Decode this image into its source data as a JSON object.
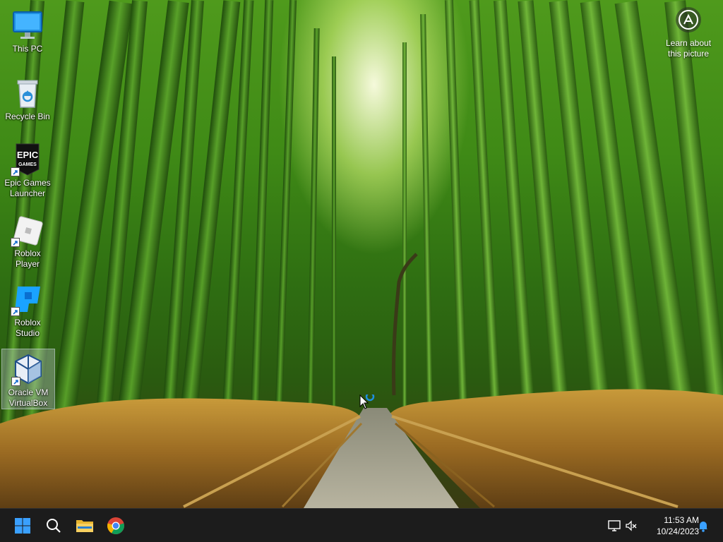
{
  "desktop": {
    "icons": [
      {
        "label": "This PC",
        "icon": "monitor-icon"
      },
      {
        "label": "Recycle Bin",
        "icon": "recycle-bin-icon"
      },
      {
        "label": "Epic Games Launcher",
        "icon": "epic-games-icon"
      },
      {
        "label": "Roblox Player",
        "icon": "roblox-player-icon"
      },
      {
        "label": "Roblox Studio",
        "icon": "roblox-studio-icon"
      },
      {
        "label": "Oracle VM VirtualBox",
        "icon": "virtualbox-icon"
      }
    ],
    "learn_about_picture": "Learn about this picture",
    "epic_logo_text": "EPIC GAMES"
  },
  "taskbar": {
    "items": [
      {
        "name": "start",
        "icon": "windows-start-icon"
      },
      {
        "name": "search",
        "icon": "search-icon"
      },
      {
        "name": "file-explorer",
        "icon": "folder-icon"
      },
      {
        "name": "chrome",
        "icon": "chrome-icon"
      }
    ],
    "clock": {
      "time": "11:53 AM",
      "date": "10/24/2023"
    },
    "tray": [
      "network-icon",
      "volume-muted-icon",
      "notification-bell-icon"
    ]
  },
  "colors": {
    "taskbar_bg": "#1c1c1c",
    "windows_blue": "#3aa0ff",
    "bamboo_green": "#4f9a1c"
  }
}
